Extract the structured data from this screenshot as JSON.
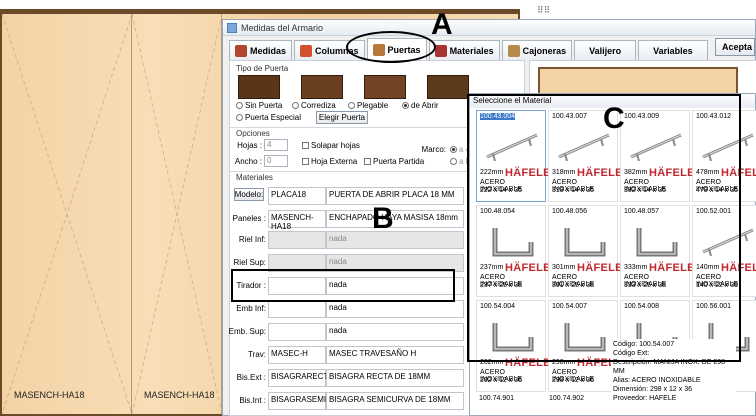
{
  "background": {
    "door_left_label": "MASENCH-HA18",
    "door_right_label": "MASENCH-HA18"
  },
  "window": {
    "title": "Medidas del Armario",
    "accept": "Acepta",
    "tabs": [
      {
        "label": "Medidas",
        "color": "#b0462e"
      },
      {
        "label": "Columnas",
        "color": "#d4502d"
      },
      {
        "label": "Puertas",
        "color": "#b8773a"
      },
      {
        "label": "Materiales",
        "color": "#a33"
      },
      {
        "label": "Cajoneras",
        "color": "#b58a4a"
      },
      {
        "label": "Valijero",
        "color": ""
      },
      {
        "label": "Variables",
        "color": ""
      }
    ]
  },
  "puertas": {
    "tipo_title": "Tipo de Puerta",
    "tipos": [
      "Sin Puerta",
      "Corrediza",
      "Plegable",
      "de Abrir"
    ],
    "tipo_selected": "de Abrir",
    "puerta_especial": "Puerta Especial",
    "elegir_button": "Elegir Puerta",
    "opciones_title": "Opciones",
    "hojas_label": "Hojas :",
    "hojas_value": "4",
    "ancho_label": "Ancho :",
    "ancho_value": "0",
    "solapar": "Solapar hojas",
    "externa": "Hoja Externa",
    "partida": "Puerta Partida",
    "marco_label": "Marco:",
    "marco_opt1": "a 45",
    "marco_opt2": "a R",
    "materiales_title": "Materiales",
    "rows": [
      {
        "label": "Modelo:",
        "code": "PLACA18",
        "desc": "PUERTA DE ABRIR PLACA 18 MM",
        "button": true
      },
      {
        "label": "Paneles :",
        "code": "MASENCH-HA18",
        "desc": "ENCHAPADO HAYA MASISA 18mm"
      },
      {
        "label": "Riel Inf:",
        "code": "",
        "desc": "nada",
        "gray": true
      },
      {
        "label": "Riel Sup:",
        "code": "",
        "desc": "nada",
        "gray": true
      },
      {
        "label": "Tirador :",
        "code": "",
        "desc": "nada"
      },
      {
        "label": "Emb Inf:",
        "code": "",
        "desc": "nada"
      },
      {
        "label": "Emb. Sup:",
        "code": "",
        "desc": "nada"
      },
      {
        "label": "Trav:",
        "code": "MASEC-H",
        "desc": "MASEC TRAVESAÑO H"
      },
      {
        "label": "Bis.Ext :",
        "code": "BISAGRARECTA",
        "desc": "BISAGRA RECTA DE 18MM"
      },
      {
        "label": "Bis.Int :",
        "code": "BISAGRASEMIC",
        "desc": "BISAGRA SEMICURVA DE 18MM"
      }
    ]
  },
  "picker": {
    "title": "Seleccione el Material",
    "items": [
      {
        "code": "100.43.004",
        "len": "222mm",
        "mat": "ACERO INOXIDABLE",
        "dim": "222 x 14 x 35",
        "kind": "bar",
        "selected": true
      },
      {
        "code": "100.43.007",
        "len": "318mm",
        "mat": "ACERO INOXIDABLE",
        "dim": "318 x 14 x 35",
        "kind": "bar"
      },
      {
        "code": "100.43.009",
        "len": "382mm",
        "mat": "ACERO INOXIDABLE",
        "dim": "382 x 14 x 35",
        "kind": "bar"
      },
      {
        "code": "100.43.012",
        "len": "478mm",
        "mat": "ACERO INOXIDABLE",
        "dim": "478 x 14 x 35",
        "kind": "bar"
      },
      {
        "code": "100.48.054",
        "len": "237mm",
        "mat": "ACERO INOXIDABLE",
        "dim": "237 x 25 x 38",
        "kind": "square"
      },
      {
        "code": "100.48.056",
        "len": "301mm",
        "mat": "ACERO INOXIDABLE",
        "dim": "301 x 25 x 38",
        "kind": "square"
      },
      {
        "code": "100.48.057",
        "len": "333mm",
        "mat": "ACERO INOXIDABLE",
        "dim": "333 x 25 x 38",
        "kind": "square"
      },
      {
        "code": "100.52.001",
        "len": "140mm",
        "mat": "ACERO INOXIDABLE",
        "dim": "140 x 22 x 39",
        "kind": "bar"
      },
      {
        "code": "100.54.004",
        "len": "202mm",
        "mat": "ACERO INOXIDABLE",
        "dim": "202 x 12 x 36",
        "kind": "square"
      },
      {
        "code": "100.54.007",
        "len": "298mm",
        "mat": "ACERO INOXIDABLE",
        "dim": "298 x 12 x 36",
        "kind": "square"
      },
      {
        "code": "100.54.008",
        "len": "",
        "mat": "",
        "dim": "",
        "kind": "square"
      },
      {
        "code": "100.56.001",
        "len": "",
        "mat": "",
        "dim": "",
        "kind": "square"
      }
    ],
    "brand": "HÄFELE",
    "more_codes": [
      "100.74.901",
      "100.74.902"
    ],
    "tooltip": {
      "codigo": "Código: 100.54.007",
      "codigo_ext": "Código Ext:",
      "descripcion": "Descripción: MANIJA INOX. DE 298 MM",
      "alias": "Alias: ACERO INOXIDABLE",
      "dimension": "Dimensión: 298 x 12 x 36",
      "proveedor": "Proveedor: HAFELE"
    }
  },
  "annotations": {
    "a": "A",
    "b": "B",
    "c": "C"
  }
}
